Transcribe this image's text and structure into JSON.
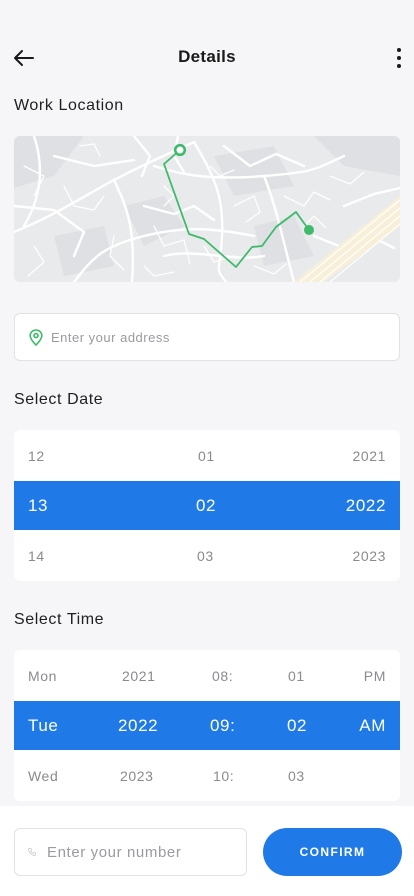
{
  "header": {
    "title": "Details",
    "back_icon": "arrow-left-icon",
    "menu_icon": "more-vertical-icon"
  },
  "work_location": {
    "label": "Work Location",
    "address_placeholder": "Enter your address",
    "address_icon": "location-pin-icon",
    "route_color": "#3dbb6b"
  },
  "select_date": {
    "label": "Select Date",
    "rows": [
      {
        "day": "12",
        "month": "01",
        "year": "2021"
      },
      {
        "day": "13",
        "month": "02",
        "year": "2022",
        "selected": true
      },
      {
        "day": "14",
        "month": "03",
        "year": "2023"
      }
    ]
  },
  "select_time": {
    "label": "Select Time",
    "rows": [
      {
        "weekday": "Mon",
        "year": "2021",
        "hour": "08:",
        "minute": "01",
        "period": "PM"
      },
      {
        "weekday": "Tue",
        "year": "2022",
        "hour": "09:",
        "minute": "02",
        "period": "AM",
        "selected": true
      },
      {
        "weekday": "Wed",
        "year": "2023",
        "hour": "10:",
        "minute": "03",
        "period": ""
      }
    ]
  },
  "bottom": {
    "phone_placeholder": "Enter your number",
    "phone_icon": "phone-icon",
    "confirm_label": "CONFIRM"
  },
  "colors": {
    "accent": "#1f7ae8",
    "background": "#f6f6f8",
    "map_base": "#e9eaec"
  }
}
